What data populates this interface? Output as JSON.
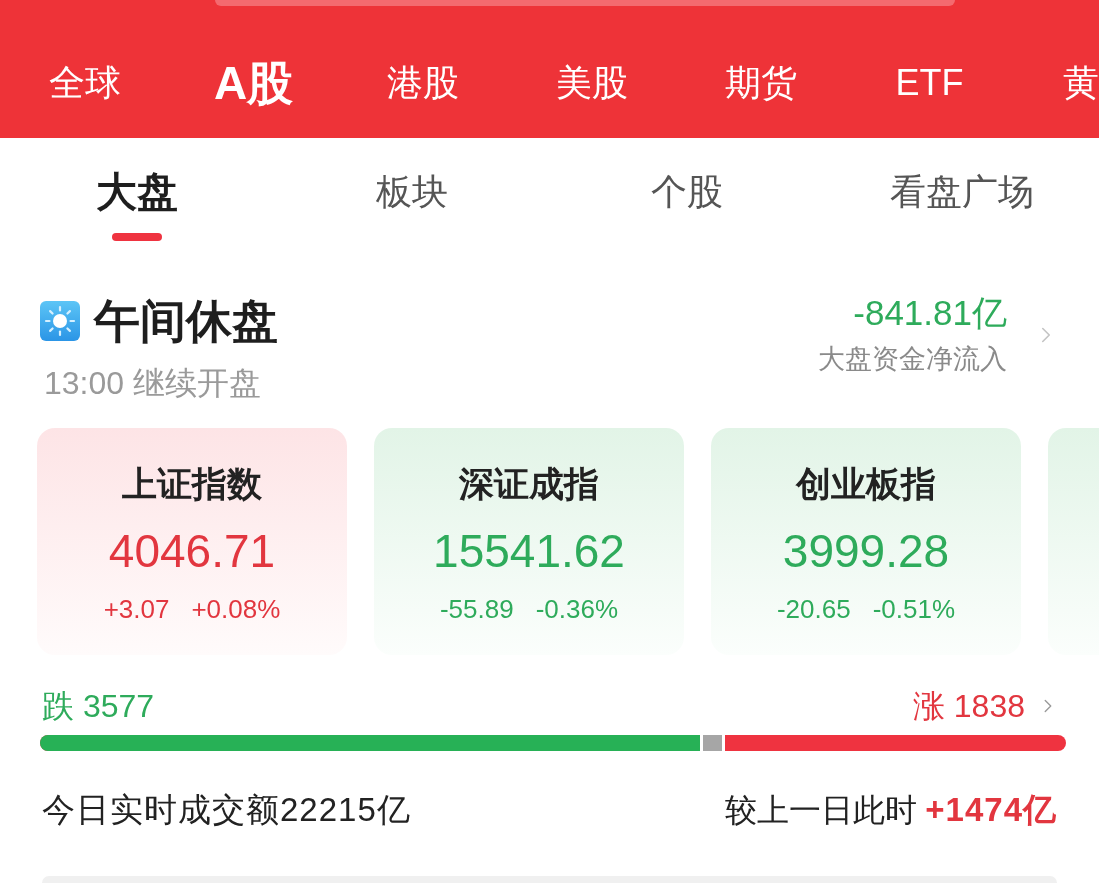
{
  "market_tabs": [
    {
      "label": "全球",
      "selected": false
    },
    {
      "label": "A股",
      "selected": true
    },
    {
      "label": "港股",
      "selected": false
    },
    {
      "label": "美股",
      "selected": false
    },
    {
      "label": "期货",
      "selected": false
    },
    {
      "label": "ETF",
      "selected": false
    },
    {
      "label": "黄",
      "selected": false
    }
  ],
  "view_tabs": [
    {
      "label": "大盘",
      "selected": true
    },
    {
      "label": "板块",
      "selected": false
    },
    {
      "label": "个股",
      "selected": false
    },
    {
      "label": "看盘广场",
      "selected": false
    }
  ],
  "session": {
    "title": "午间休盘",
    "subtitle": "13:00 继续开盘"
  },
  "capital_flow": {
    "value": "-841.81亿",
    "label": "大盘资金净流入",
    "rising": false
  },
  "indices": [
    {
      "name": "上证指数",
      "value": "4046.71",
      "change": "+3.07",
      "change_pct": "+0.08%",
      "rising": true
    },
    {
      "name": "深证成指",
      "value": "15541.62",
      "change": "-55.89",
      "change_pct": "-0.36%",
      "rising": false
    },
    {
      "name": "创业板指",
      "value": "3999.28",
      "change": "-20.65",
      "change_pct": "-0.51%",
      "rising": false
    },
    {
      "rising": false
    }
  ],
  "breadth": {
    "down": "跌 3577",
    "up": "涨 1838",
    "level": 0.643
  },
  "turnover": {
    "label": "今日实时成交额22215亿",
    "comparison_label": "较上一日此时",
    "comparison_value": "+1474亿",
    "rising": true
  }
}
